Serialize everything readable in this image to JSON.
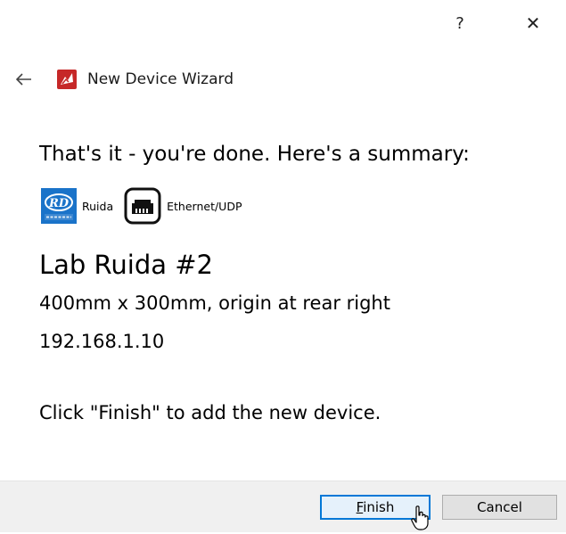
{
  "titlebar": {
    "help_label": "?",
    "close_label": "✕"
  },
  "header": {
    "back_icon": "back-arrow-icon",
    "app_icon": "lightburn-app-icon",
    "title": "New Device Wizard"
  },
  "summary": {
    "intro": "That's it - you're done.  Here's a summary:",
    "controller_label": "Ruida",
    "connection_label": "Ethernet/UDP",
    "device_name": "Lab Ruida #2",
    "size_origin": "400mm x 300mm, origin at rear right",
    "ip_address": "192.168.1.10",
    "finish_hint": "Click \"Finish\" to add the new device."
  },
  "footer": {
    "finish_label": "Finish",
    "cancel_label": "Cancel"
  },
  "colors": {
    "accent": "#0078d7",
    "rd_logo_blue": "#1a73c9",
    "footer_bg": "#f0f0f0"
  }
}
